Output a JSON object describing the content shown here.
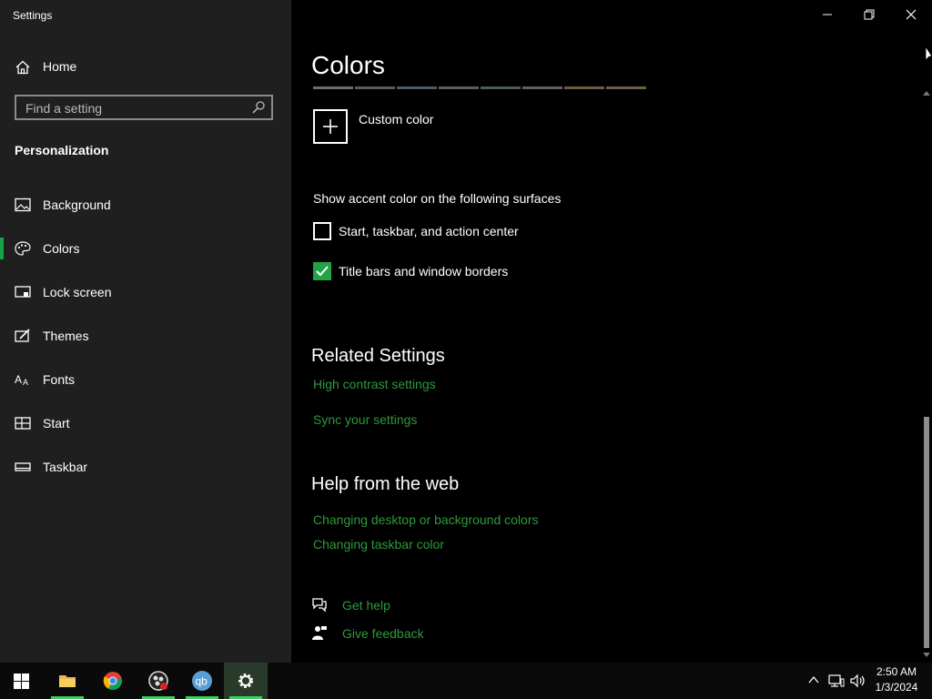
{
  "window": {
    "title": "Settings"
  },
  "sidebar": {
    "home_label": "Home",
    "search_placeholder": "Find a setting",
    "section_title": "Personalization",
    "items": [
      {
        "label": "Background",
        "icon": "image-icon"
      },
      {
        "label": "Colors",
        "icon": "palette-icon",
        "selected": true
      },
      {
        "label": "Lock screen",
        "icon": "lock-screen-icon"
      },
      {
        "label": "Themes",
        "icon": "brush-icon"
      },
      {
        "label": "Fonts",
        "icon": "font-icon"
      },
      {
        "label": "Start",
        "icon": "start-layout-icon"
      },
      {
        "label": "Taskbar",
        "icon": "taskbar-icon"
      }
    ]
  },
  "main": {
    "title": "Colors",
    "swatch_colors": [
      "#6b6b6b",
      "#5a5a5a",
      "#4f5a66",
      "#5c5c5c",
      "#4d5c55",
      "#5f5f5f",
      "#6b5a3f",
      "#6b5f4a"
    ],
    "custom_color_label": "Custom color",
    "accent_heading": "Show accent color on the following surfaces",
    "checkboxes": [
      {
        "label": "Start, taskbar, and action center",
        "checked": false
      },
      {
        "label": "Title bars and window borders",
        "checked": true
      }
    ],
    "related_heading": "Related Settings",
    "related_links": [
      "High contrast settings",
      "Sync your settings"
    ],
    "help_heading": "Help from the web",
    "help_links": [
      "Changing desktop or background colors",
      "Changing taskbar color"
    ],
    "get_help": "Get help",
    "give_feedback": "Give feedback"
  },
  "colors": {
    "accent": "#2d9a3c",
    "sidebar_bg": "#1f1f1f",
    "main_bg": "#000000"
  },
  "taskbar": {
    "apps": [
      "start-button",
      "file-explorer",
      "chrome",
      "obs-studio",
      "qbittorrent",
      "settings"
    ],
    "clock_time": "2:50 AM",
    "clock_date": "1/3/2024"
  }
}
